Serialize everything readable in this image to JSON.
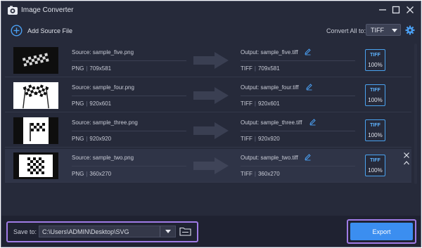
{
  "window": {
    "title": "Image Converter"
  },
  "toolbar": {
    "add_label": "Add Source File",
    "convert_label": "Convert All to:",
    "format_value": "TIFF"
  },
  "files": [
    {
      "source": "Source: sample_five.png",
      "src_fmt": "PNG",
      "src_dim": "709x581",
      "output": "Output: sample_five.tiff",
      "out_fmt": "TIFF",
      "out_dim": "709x581",
      "badge": "TIFF",
      "pct": "100%"
    },
    {
      "source": "Source: sample_four.png",
      "src_fmt": "PNG",
      "src_dim": "920x601",
      "output": "Output: sample_four.tiff",
      "out_fmt": "TIFF",
      "out_dim": "920x601",
      "badge": "TIFF",
      "pct": "100%"
    },
    {
      "source": "Source: sample_three.png",
      "src_fmt": "PNG",
      "src_dim": "920x920",
      "output": "Output: sample_three.tiff",
      "out_fmt": "TIFF",
      "out_dim": "920x920",
      "badge": "TIFF",
      "pct": "100%"
    },
    {
      "source": "Source: sample_two.png",
      "src_fmt": "PNG",
      "src_dim": "360x270",
      "output": "Output: sample_two.tiff",
      "out_fmt": "TIFF",
      "out_dim": "360x270",
      "badge": "TIFF",
      "pct": "100%"
    }
  ],
  "bottom": {
    "save_label": "Save to:",
    "save_path": "C:\\Users\\ADMIN\\Desktop\\SVG",
    "export_label": "Export"
  },
  "colors": {
    "background": "#262a3a",
    "accent": "#3b8ef0",
    "highlight": "#a07be6",
    "badge_border": "#4aa3f0"
  }
}
